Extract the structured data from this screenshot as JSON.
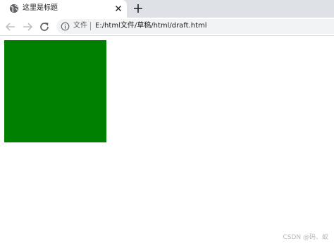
{
  "browser": {
    "tab": {
      "title": "这里是标题",
      "favicon": "globe-icon",
      "close_icon": "close-icon"
    },
    "new_tab_icon": "plus-icon",
    "toolbar": {
      "back_icon": "back-arrow-icon",
      "forward_icon": "forward-arrow-icon",
      "reload_icon": "reload-icon"
    },
    "omnibox": {
      "info_icon": "info-icon",
      "security_label": "文件",
      "url": "E:/html文件/草稿/html/draft.html"
    }
  },
  "page": {
    "box_color": "#008000"
  },
  "watermark": "CSDN @码、蚁"
}
